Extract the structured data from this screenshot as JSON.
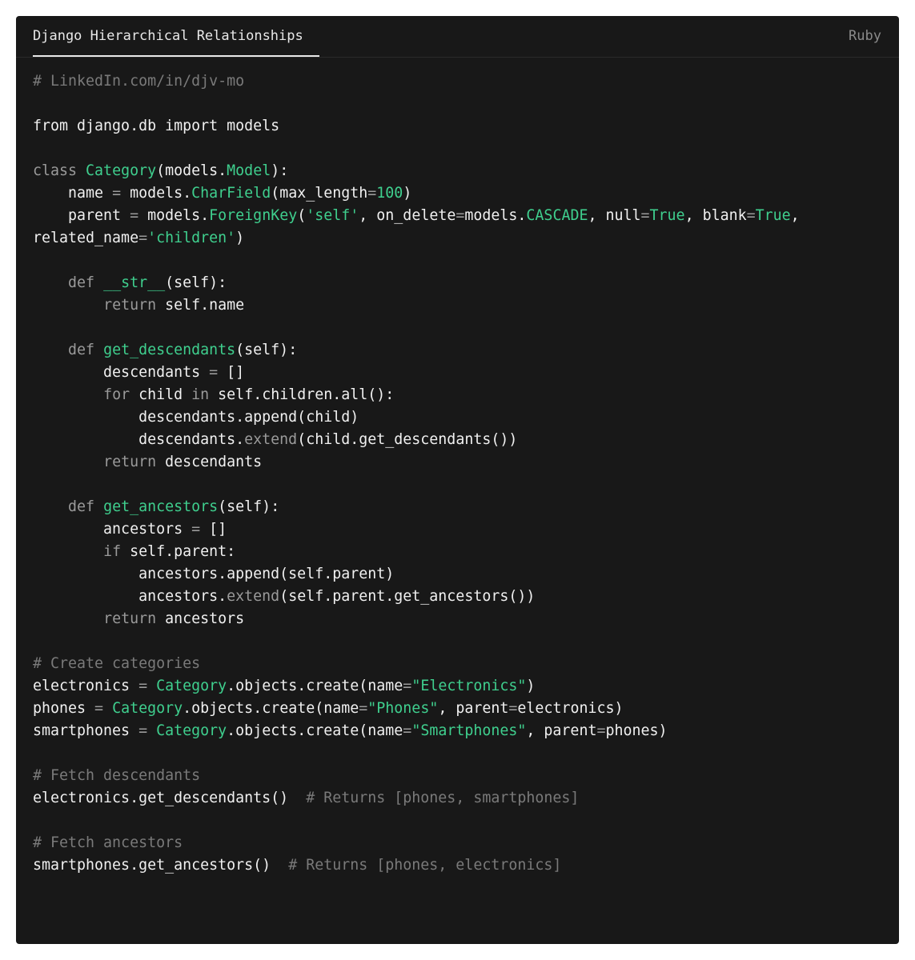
{
  "window": {
    "tab_title": "Django Hierarchical Relationships",
    "language": "Ruby"
  },
  "colors": {
    "background": "#181818",
    "plain": "#f0f0f0",
    "comment": "#7a7a7a",
    "keyword": "#9a9a9a",
    "accent": "#3fcf8e"
  },
  "code_lines": [
    [
      [
        "comment",
        "# LinkedIn.com/in/djv-mo"
      ]
    ],
    [],
    [
      [
        "plain",
        "from django.db import models"
      ]
    ],
    [],
    [
      [
        "kw",
        "class "
      ],
      [
        "cls",
        "Category"
      ],
      [
        "plain",
        "(models."
      ],
      [
        "cls",
        "Model"
      ],
      [
        "plain",
        "):"
      ]
    ],
    [
      [
        "plain",
        "    name "
      ],
      [
        "op",
        "="
      ],
      [
        "plain",
        " models."
      ],
      [
        "cls",
        "CharField"
      ],
      [
        "plain",
        "(max_length"
      ],
      [
        "op",
        "="
      ],
      [
        "cls",
        "100"
      ],
      [
        "plain",
        ")"
      ]
    ],
    [
      [
        "plain",
        "    parent "
      ],
      [
        "op",
        "="
      ],
      [
        "plain",
        " models."
      ],
      [
        "cls",
        "ForeignKey"
      ],
      [
        "plain",
        "("
      ],
      [
        "str",
        "'self'"
      ],
      [
        "plain",
        ", on_delete"
      ],
      [
        "op",
        "="
      ],
      [
        "plain",
        "models."
      ],
      [
        "cls",
        "CASCADE"
      ],
      [
        "plain",
        ", null"
      ],
      [
        "op",
        "="
      ],
      [
        "cls",
        "True"
      ],
      [
        "plain",
        ", blank"
      ],
      [
        "op",
        "="
      ],
      [
        "cls",
        "True"
      ],
      [
        "plain",
        ","
      ]
    ],
    [
      [
        "plain",
        "related_name"
      ],
      [
        "op",
        "="
      ],
      [
        "str",
        "'children'"
      ],
      [
        "plain",
        ")"
      ]
    ],
    [],
    [
      [
        "plain",
        "    "
      ],
      [
        "kw",
        "def "
      ],
      [
        "cls",
        "__str__"
      ],
      [
        "plain",
        "(self):"
      ]
    ],
    [
      [
        "plain",
        "        "
      ],
      [
        "kw",
        "return "
      ],
      [
        "plain",
        "self.name"
      ]
    ],
    [],
    [
      [
        "plain",
        "    "
      ],
      [
        "kw",
        "def "
      ],
      [
        "cls",
        "get_descendants"
      ],
      [
        "plain",
        "(self):"
      ]
    ],
    [
      [
        "plain",
        "        descendants "
      ],
      [
        "op",
        "="
      ],
      [
        "plain",
        " []"
      ]
    ],
    [
      [
        "plain",
        "        "
      ],
      [
        "kw",
        "for "
      ],
      [
        "plain",
        "child "
      ],
      [
        "kw",
        "in "
      ],
      [
        "plain",
        "self.children.all():"
      ]
    ],
    [
      [
        "plain",
        "            descendants.append(child)"
      ]
    ],
    [
      [
        "plain",
        "            descendants."
      ],
      [
        "kw",
        "extend"
      ],
      [
        "plain",
        "(child.get_descendants())"
      ]
    ],
    [
      [
        "plain",
        "        "
      ],
      [
        "kw",
        "return "
      ],
      [
        "plain",
        "descendants"
      ]
    ],
    [],
    [
      [
        "plain",
        "    "
      ],
      [
        "kw",
        "def "
      ],
      [
        "cls",
        "get_ancestors"
      ],
      [
        "plain",
        "(self):"
      ]
    ],
    [
      [
        "plain",
        "        ancestors "
      ],
      [
        "op",
        "="
      ],
      [
        "plain",
        " []"
      ]
    ],
    [
      [
        "plain",
        "        "
      ],
      [
        "kw",
        "if "
      ],
      [
        "plain",
        "self.parent:"
      ]
    ],
    [
      [
        "plain",
        "            ancestors.append(self.parent)"
      ]
    ],
    [
      [
        "plain",
        "            ancestors."
      ],
      [
        "kw",
        "extend"
      ],
      [
        "plain",
        "(self.parent.get_ancestors())"
      ]
    ],
    [
      [
        "plain",
        "        "
      ],
      [
        "kw",
        "return "
      ],
      [
        "plain",
        "ancestors"
      ]
    ],
    [],
    [
      [
        "comment",
        "# Create categories"
      ]
    ],
    [
      [
        "plain",
        "electronics "
      ],
      [
        "op",
        "="
      ],
      [
        "plain",
        " "
      ],
      [
        "cls",
        "Category"
      ],
      [
        "plain",
        ".objects.create(name"
      ],
      [
        "op",
        "="
      ],
      [
        "str",
        "\"Electronics\""
      ],
      [
        "plain",
        ")"
      ]
    ],
    [
      [
        "plain",
        "phones "
      ],
      [
        "op",
        "="
      ],
      [
        "plain",
        " "
      ],
      [
        "cls",
        "Category"
      ],
      [
        "plain",
        ".objects.create(name"
      ],
      [
        "op",
        "="
      ],
      [
        "str",
        "\"Phones\""
      ],
      [
        "plain",
        ", parent"
      ],
      [
        "op",
        "="
      ],
      [
        "plain",
        "electronics)"
      ]
    ],
    [
      [
        "plain",
        "smartphones "
      ],
      [
        "op",
        "="
      ],
      [
        "plain",
        " "
      ],
      [
        "cls",
        "Category"
      ],
      [
        "plain",
        ".objects.create(name"
      ],
      [
        "op",
        "="
      ],
      [
        "str",
        "\"Smartphones\""
      ],
      [
        "plain",
        ", parent"
      ],
      [
        "op",
        "="
      ],
      [
        "plain",
        "phones)"
      ]
    ],
    [],
    [
      [
        "comment",
        "# Fetch descendants"
      ]
    ],
    [
      [
        "plain",
        "electronics.get_descendants()  "
      ],
      [
        "comment",
        "# Returns [phones, smartphones]"
      ]
    ],
    [],
    [
      [
        "comment",
        "# Fetch ancestors"
      ]
    ],
    [
      [
        "plain",
        "smartphones.get_ancestors()  "
      ],
      [
        "comment",
        "# Returns [phones, electronics]"
      ]
    ]
  ]
}
